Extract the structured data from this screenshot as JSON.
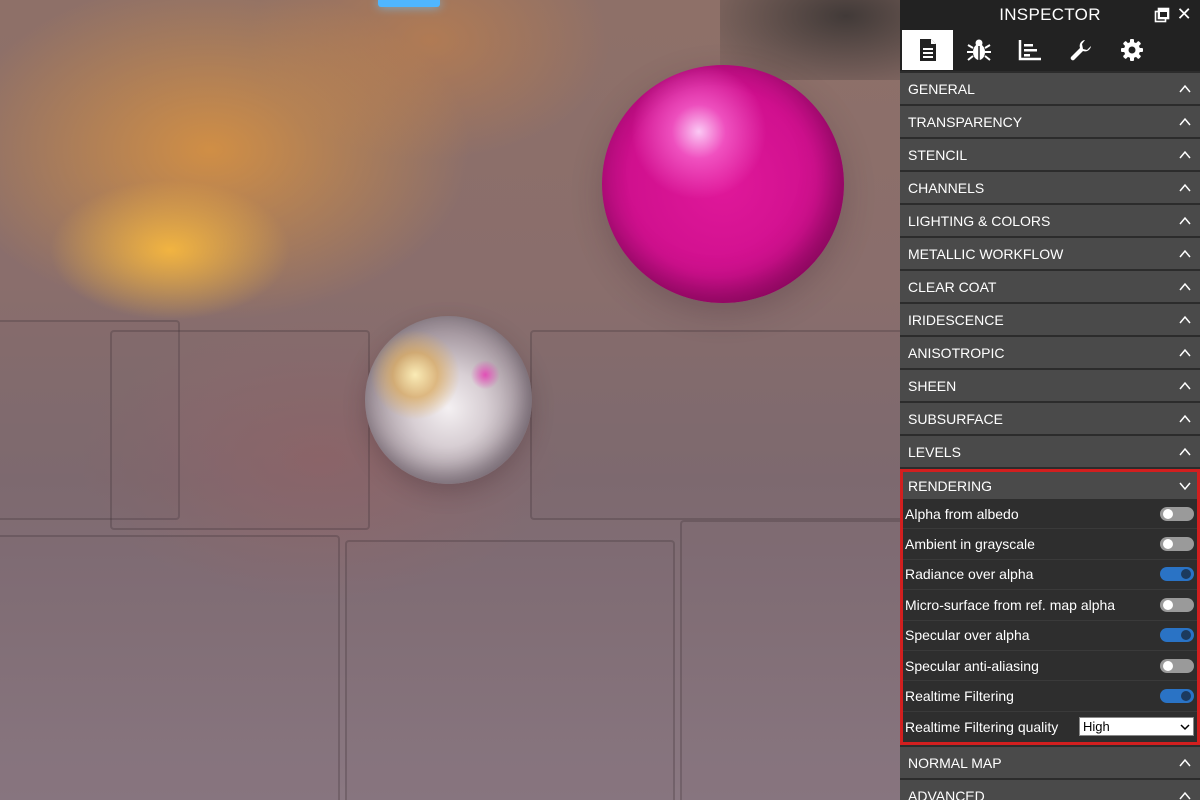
{
  "inspector": {
    "title": "INSPECTOR",
    "tabs": [
      {
        "icon": "properties-document-icon",
        "active": true
      },
      {
        "icon": "debug-bug-icon",
        "active": false
      },
      {
        "icon": "statistics-chart-icon",
        "active": false
      },
      {
        "icon": "tools-wrench-icon",
        "active": false
      },
      {
        "icon": "settings-gear-icon",
        "active": false
      }
    ],
    "sections_before": [
      "GENERAL",
      "TRANSPARENCY",
      "STENCIL",
      "CHANNELS",
      "LIGHTING & COLORS",
      "METALLIC WORKFLOW",
      "CLEAR COAT",
      "IRIDESCENCE",
      "ANISOTROPIC",
      "SHEEN",
      "SUBSURFACE",
      "LEVELS"
    ],
    "rendering": {
      "title": "RENDERING",
      "toggles": [
        {
          "label": "Alpha from albedo",
          "on": false
        },
        {
          "label": "Ambient in grayscale",
          "on": false
        },
        {
          "label": "Radiance over alpha",
          "on": true
        },
        {
          "label": "Micro-surface from ref. map alpha",
          "on": false
        },
        {
          "label": "Specular over alpha",
          "on": true
        },
        {
          "label": "Specular anti-aliasing",
          "on": false
        },
        {
          "label": "Realtime Filtering",
          "on": true
        }
      ],
      "quality": {
        "label": "Realtime Filtering quality",
        "value": "High"
      }
    },
    "sections_after": [
      "NORMAL MAP",
      "ADVANCED"
    ]
  },
  "colors": {
    "panel_bg": "#2c2c2c",
    "section_bg": "#4a4a4a",
    "highlight_border": "#d21f1f",
    "toggle_on": "#2a73c5",
    "pink_sphere": "#d0108e"
  }
}
